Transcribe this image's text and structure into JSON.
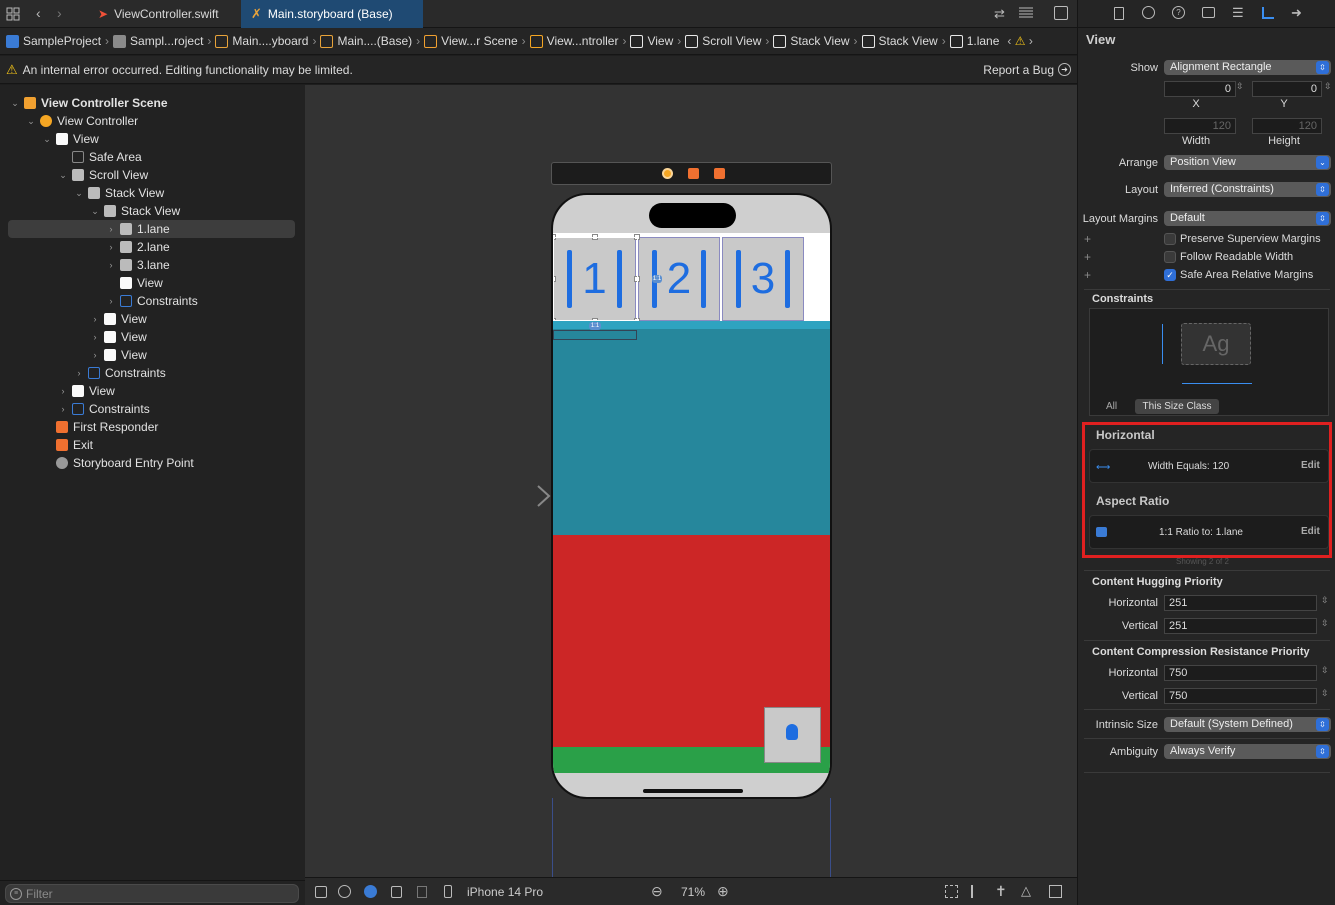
{
  "tabs": [
    {
      "label": "ViewController.swift",
      "icon": "swift-file-icon"
    },
    {
      "label": "Main.storyboard (Base)",
      "icon": "storyboard-icon"
    }
  ],
  "breadcrumb": [
    {
      "label": "SampleProject",
      "color": "#3a7bd5"
    },
    {
      "label": "Sampl...roject",
      "color": "#8a8a8a"
    },
    {
      "label": "Main....yboard",
      "color": "#e8a33a"
    },
    {
      "label": "Main....(Base)",
      "color": "#e8a33a"
    },
    {
      "label": "View...r Scene",
      "color": "#f0a030"
    },
    {
      "label": "View...ntroller",
      "color": "#f5a623"
    },
    {
      "label": "View",
      "color": "#e8e8e8"
    },
    {
      "label": "Scroll View",
      "color": "#e8e8e8"
    },
    {
      "label": "Stack View",
      "color": "#e8e8e8"
    },
    {
      "label": "Stack View",
      "color": "#e8e8e8"
    },
    {
      "label": "1.lane",
      "color": "#e8e8e8"
    }
  ],
  "warning": {
    "text": "An internal error occurred. Editing functionality may be limited.",
    "report": "Report a Bug"
  },
  "outline": [
    {
      "label": "View Controller Scene",
      "depth": 0,
      "chev": "v",
      "icon": "scene",
      "bold": true
    },
    {
      "label": "View Controller",
      "depth": 1,
      "chev": "v",
      "icon": "vc"
    },
    {
      "label": "View",
      "depth": 2,
      "chev": "v",
      "icon": "view"
    },
    {
      "label": "Safe Area",
      "depth": 3,
      "chev": "",
      "icon": "safe"
    },
    {
      "label": "Scroll View",
      "depth": 3,
      "chev": "v",
      "icon": "scroll"
    },
    {
      "label": "Stack View",
      "depth": 4,
      "chev": "v",
      "icon": "stack"
    },
    {
      "label": "Stack View",
      "depth": 5,
      "chev": "v",
      "icon": "stack"
    },
    {
      "label": "1.lane",
      "depth": 6,
      "chev": ">",
      "icon": "image",
      "selected": true
    },
    {
      "label": "2.lane",
      "depth": 6,
      "chev": ">",
      "icon": "image"
    },
    {
      "label": "3.lane",
      "depth": 6,
      "chev": ">",
      "icon": "image"
    },
    {
      "label": "View",
      "depth": 6,
      "chev": "",
      "icon": "view"
    },
    {
      "label": "Constraints",
      "depth": 6,
      "chev": ">",
      "icon": "constraints"
    },
    {
      "label": "View",
      "depth": 5,
      "chev": ">",
      "icon": "view"
    },
    {
      "label": "View",
      "depth": 5,
      "chev": ">",
      "icon": "view"
    },
    {
      "label": "View",
      "depth": 5,
      "chev": ">",
      "icon": "view"
    },
    {
      "label": "Constraints",
      "depth": 4,
      "chev": ">",
      "icon": "constraints"
    },
    {
      "label": "View",
      "depth": 3,
      "chev": ">",
      "icon": "view"
    },
    {
      "label": "Constraints",
      "depth": 3,
      "chev": ">",
      "icon": "constraints"
    },
    {
      "label": "First Responder",
      "depth": 2,
      "chev": "",
      "icon": "responder"
    },
    {
      "label": "Exit",
      "depth": 2,
      "chev": "",
      "icon": "exit"
    },
    {
      "label": "Storyboard Entry Point",
      "depth": 2,
      "chev": "",
      "icon": "entry"
    }
  ],
  "filter_placeholder": "Filter",
  "canvas": {
    "lanes": [
      "1",
      "2",
      "3"
    ],
    "ratio_badge": "1:1",
    "device": "iPhone 14 Pro",
    "zoom": "71%",
    "colors": {
      "teal": "#26879c",
      "red": "#cc2626",
      "green": "#2aa048",
      "lane_bg": "#c9c9c9",
      "accent": "#1e6de0"
    }
  },
  "inspector": {
    "title": "View",
    "show_label": "Show",
    "show_value": "Alignment Rectangle",
    "x_value": "0",
    "y_value": "0",
    "x_label": "X",
    "y_label": "Y",
    "width_value": "120",
    "height_value": "120",
    "width_label": "Width",
    "height_label": "Height",
    "arrange_label": "Arrange",
    "arrange_value": "Position View",
    "layout_label": "Layout",
    "layout_value": "Inferred (Constraints)",
    "margins_label": "Layout Margins",
    "margins_value": "Default",
    "checks": [
      {
        "label": "Preserve Superview Margins",
        "checked": false
      },
      {
        "label": "Follow Readable Width",
        "checked": false
      },
      {
        "label": "Safe Area Relative Margins",
        "checked": true
      }
    ],
    "constraints_title": "Constraints",
    "constraints_preview": "Ag",
    "seg_all": "All",
    "seg_size": "This Size Class",
    "horizontal_title": "Horizontal",
    "width_constraint": "Width Equals:  120",
    "aspect_title": "Aspect Ratio",
    "aspect_constraint": "1:1 Ratio to:  1.lane",
    "edit": "Edit",
    "showing": "Showing 2 of 2",
    "hugging_title": "Content Hugging Priority",
    "hug_h_label": "Horizontal",
    "hug_h_value": "251",
    "hug_v_label": "Vertical",
    "hug_v_value": "251",
    "resist_title": "Content Compression Resistance Priority",
    "res_h_label": "Horizontal",
    "res_h_value": "750",
    "res_v_label": "Vertical",
    "res_v_value": "750",
    "intrinsic_label": "Intrinsic Size",
    "intrinsic_value": "Default (System Defined)",
    "ambiguity_label": "Ambiguity",
    "ambiguity_value": "Always Verify"
  }
}
